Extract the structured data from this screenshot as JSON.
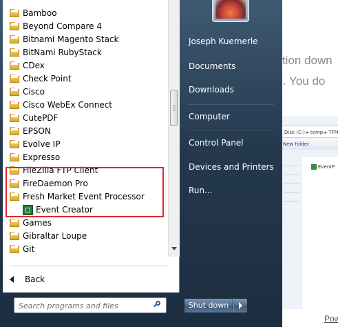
{
  "background": {
    "text_line1": "cation down",
    "text_line2": "on. You do",
    "explorer_address": "Disk (C:) ▸ temp ▸ TFM",
    "explorer_toolbar": "New folder",
    "explorer_file": "EventP",
    "bottom_link": "Pow"
  },
  "programs": {
    "items": [
      {
        "label": "Bamboo",
        "type": "folder"
      },
      {
        "label": "Beyond Compare 4",
        "type": "folder"
      },
      {
        "label": "Bitnami Magento Stack",
        "type": "folder"
      },
      {
        "label": "BitNami RubyStack",
        "type": "folder"
      },
      {
        "label": "CDex",
        "type": "folder"
      },
      {
        "label": "Check Point",
        "type": "folder"
      },
      {
        "label": "Cisco",
        "type": "folder"
      },
      {
        "label": "Cisco WebEx Connect",
        "type": "folder"
      },
      {
        "label": "CutePDF",
        "type": "folder"
      },
      {
        "label": "EPSON",
        "type": "folder"
      },
      {
        "label": "Evolve IP",
        "type": "folder"
      },
      {
        "label": "Expresso",
        "type": "folder"
      },
      {
        "label": "FileZilla FTP Client",
        "type": "folder"
      },
      {
        "label": "FireDaemon Pro",
        "type": "folder"
      },
      {
        "label": "Fresh Market Event Processor",
        "type": "folder"
      },
      {
        "label": "Event Creator",
        "type": "app"
      },
      {
        "label": "Games",
        "type": "folder"
      },
      {
        "label": "Gibraltar Loupe",
        "type": "folder"
      },
      {
        "label": "Git",
        "type": "folder"
      }
    ],
    "back_label": "Back"
  },
  "search": {
    "placeholder": "Search programs and files"
  },
  "right_pane": {
    "user_name": "Joseph Kuemerle",
    "items": [
      "Documents",
      "Downloads",
      "Computer",
      "Control Panel",
      "Devices and Printers",
      "Run..."
    ]
  },
  "shutdown": {
    "label": "Shut down"
  },
  "colors": {
    "highlight_border": "#e0262b",
    "menu_dark": "#24394e"
  }
}
